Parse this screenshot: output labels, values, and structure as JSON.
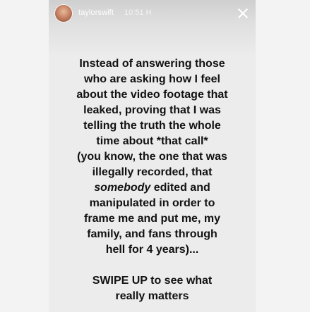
{
  "story": {
    "username": "taylorswift",
    "timestamp": "10:51 H",
    "avatar_icon": "profile-avatar-icon",
    "close_icon": "close-icon",
    "caption_lines": [
      "Instead of answering those",
      "who are asking how I feel",
      "about the video footage that",
      "leaked, proving that I was",
      "telling the truth the whole",
      "time about *that call*",
      "(you know, the one that was",
      "illegally recorded, that"
    ],
    "caption_emph_word": "somebody",
    "caption_emph_rest": " edited and",
    "caption_lines_2": [
      "manipulated in order to",
      "frame me and put me, my",
      "family, and fans through",
      "hell for 4 years)..."
    ],
    "cta_lines": [
      "SWIPE UP to see what",
      "really matters"
    ]
  },
  "colors": {
    "background": "#f2f2f2",
    "story_background": "#ececec",
    "text": "#111111",
    "header_text": "#ffffff"
  }
}
